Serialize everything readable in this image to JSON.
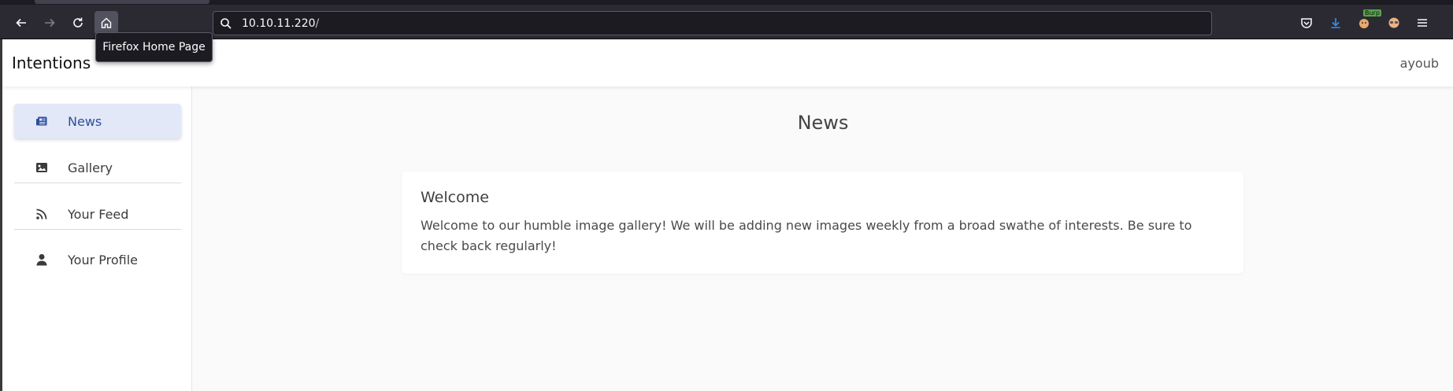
{
  "browser": {
    "url_host": "10.10.11.220",
    "url_path": "/",
    "tooltip": "Firefox Home Page",
    "burp_badge": "Burp"
  },
  "app": {
    "brand": "Intentions",
    "user": "ayoub"
  },
  "sidebar": {
    "items": [
      {
        "label": "News",
        "icon": "newspaper-icon",
        "active": true
      },
      {
        "label": "Gallery",
        "icon": "image-icon",
        "active": false
      },
      {
        "label": "Your Feed",
        "icon": "rss-icon",
        "active": false
      },
      {
        "label": "Your Profile",
        "icon": "user-icon",
        "active": false
      }
    ]
  },
  "main": {
    "title": "News",
    "card": {
      "title": "Welcome",
      "text": "Welcome to our humble image gallery! We will be adding new images weekly from a broad swathe of interests. Be sure to check back regularly!"
    }
  },
  "colors": {
    "active_bg": "#e3e8f8",
    "active_text": "#2d4f9c",
    "chrome_bg": "#2b2a33"
  }
}
